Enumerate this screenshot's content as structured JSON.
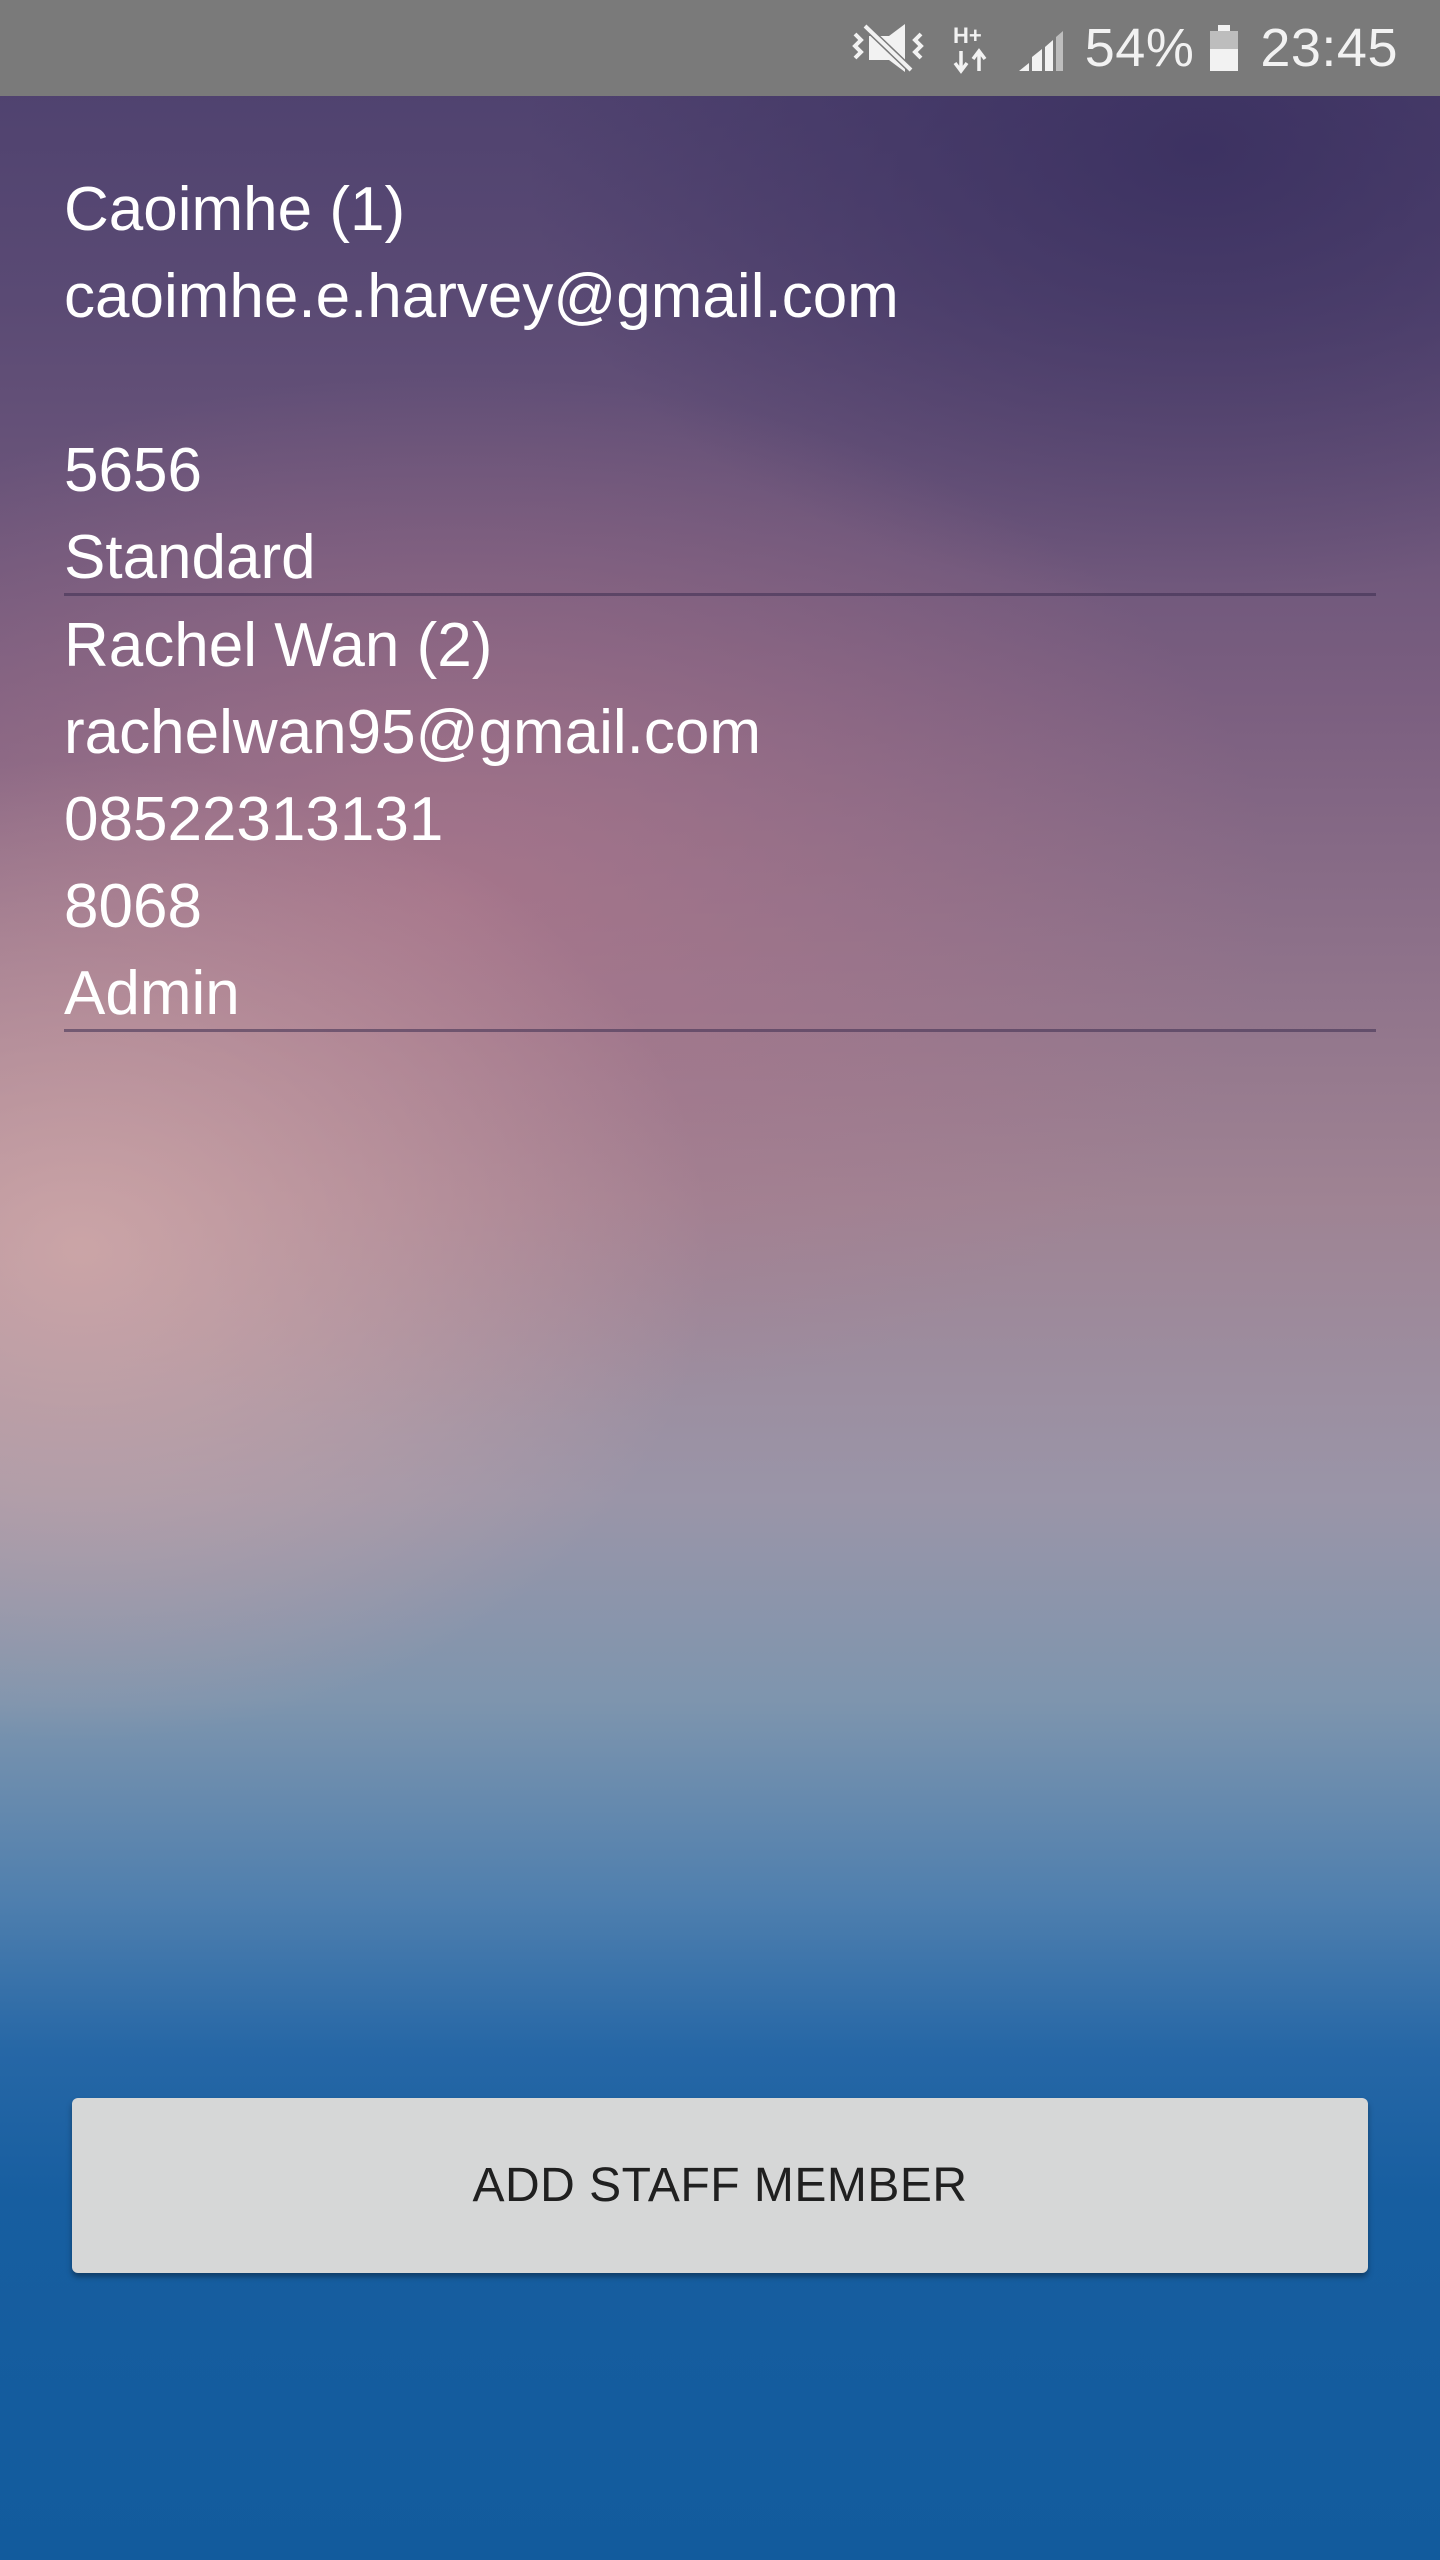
{
  "status_bar": {
    "icons": [
      "vibrate-mode-icon",
      "data-hplus-icon",
      "cell-signal-icon",
      "battery-icon"
    ],
    "data_type": "H+",
    "battery": "54%",
    "time": "23:45"
  },
  "staff": [
    {
      "name": "Caoimhe (1)",
      "email": "caoimhe.e.harvey@gmail.com",
      "phone": "",
      "pin": "5656",
      "role": "Standard"
    },
    {
      "name": "Rachel Wan (2)",
      "email": "rachelwan95@gmail.com",
      "phone": "08522313131",
      "pin": "8068",
      "role": "Admin"
    }
  ],
  "add_button": {
    "label": "ADD STAFF MEMBER"
  },
  "colors": {
    "status_bar": "#7a7a7a",
    "button_bg": "#d6d7d7",
    "button_text": "#202020",
    "text": "#ffffff"
  }
}
